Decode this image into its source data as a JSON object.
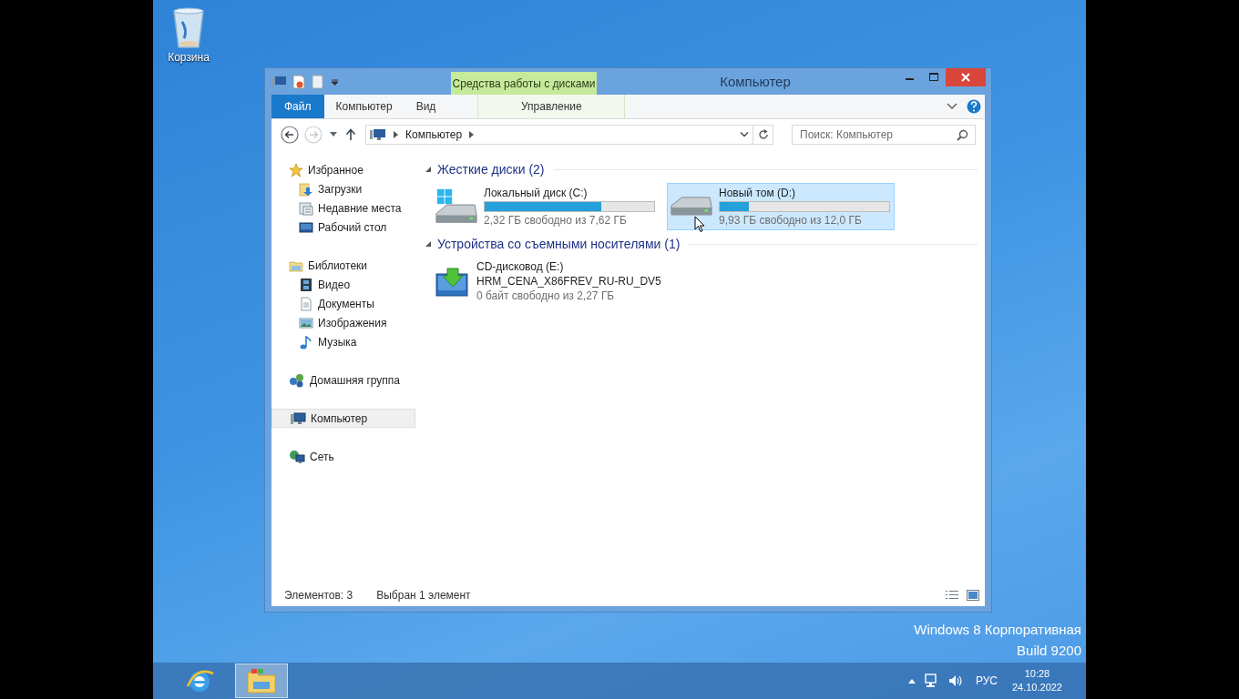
{
  "desktop_icons": [
    {
      "label": "Корзина",
      "kind": "recycle-bin"
    }
  ],
  "window": {
    "title": "Компьютер",
    "contextual_group": "Средства работы с дисками",
    "ribbon_tabs": [
      {
        "label": "Файл",
        "kind": "file",
        "selected": false
      },
      {
        "label": "Компьютер",
        "kind": "tab",
        "selected": false
      },
      {
        "label": "Вид",
        "kind": "tab",
        "selected": false
      },
      {
        "label": "Управление",
        "kind": "contextual",
        "selected": false
      }
    ],
    "address": {
      "path": [
        "Компьютер"
      ]
    },
    "search": {
      "placeholder": "Поиск: Компьютер"
    },
    "navigation": [
      {
        "label": "Избранное",
        "kind": "favorites",
        "selected": false,
        "children": [
          {
            "label": "Загрузки",
            "kind": "downloads",
            "selected": false
          },
          {
            "label": "Недавние места",
            "kind": "recent",
            "selected": false
          },
          {
            "label": "Рабочий стол",
            "kind": "desktop",
            "selected": false
          }
        ]
      },
      {
        "label": "Библиотеки",
        "kind": "libraries",
        "selected": false,
        "children": [
          {
            "label": "Видео",
            "kind": "video",
            "selected": false
          },
          {
            "label": "Документы",
            "kind": "documents",
            "selected": false
          },
          {
            "label": "Изображения",
            "kind": "pictures",
            "selected": false
          },
          {
            "label": "Музыка",
            "kind": "music",
            "selected": false
          }
        ]
      },
      {
        "label": "Домашняя группа",
        "kind": "homegroup",
        "selected": false
      },
      {
        "label": "Компьютер",
        "kind": "computer",
        "selected": true
      },
      {
        "label": "Сеть",
        "kind": "network",
        "selected": false
      }
    ],
    "sections": [
      {
        "title": "Жесткие диски (2)",
        "expanded": true,
        "items": [
          {
            "name": "Локальный диск (C:)",
            "kind": "system-drive",
            "level": 0.69,
            "free": "2,32 ГБ свободно из 7,62 ГБ",
            "selected": false
          },
          {
            "name": "Новый том (D:)",
            "kind": "drive",
            "level": 0.17,
            "free": "9,93 ГБ свободно из 12,0 ГБ",
            "selected": true
          }
        ]
      },
      {
        "title": "Устройства со съемными носителями (1)",
        "expanded": true,
        "items": [
          {
            "name": "CD-дисковод (E:)",
            "label": "HRM_CENA_X86FREV_RU-RU_DV5",
            "kind": "cd",
            "free": "0 байт свободно из 2,27 ГБ",
            "selected": false
          }
        ]
      }
    ],
    "status_bar": {
      "count": "Элементов: 3",
      "selection": "Выбран 1 элемент"
    }
  },
  "edition": [
    "Windows 8 Корпоративная",
    "Build 9200"
  ],
  "taskbar": {
    "apps": [
      {
        "kind": "browser",
        "selected": false
      },
      {
        "kind": "explorer",
        "selected": true
      }
    ],
    "language": "РУС",
    "time": "10:28",
    "date": "24.10.2022"
  }
}
